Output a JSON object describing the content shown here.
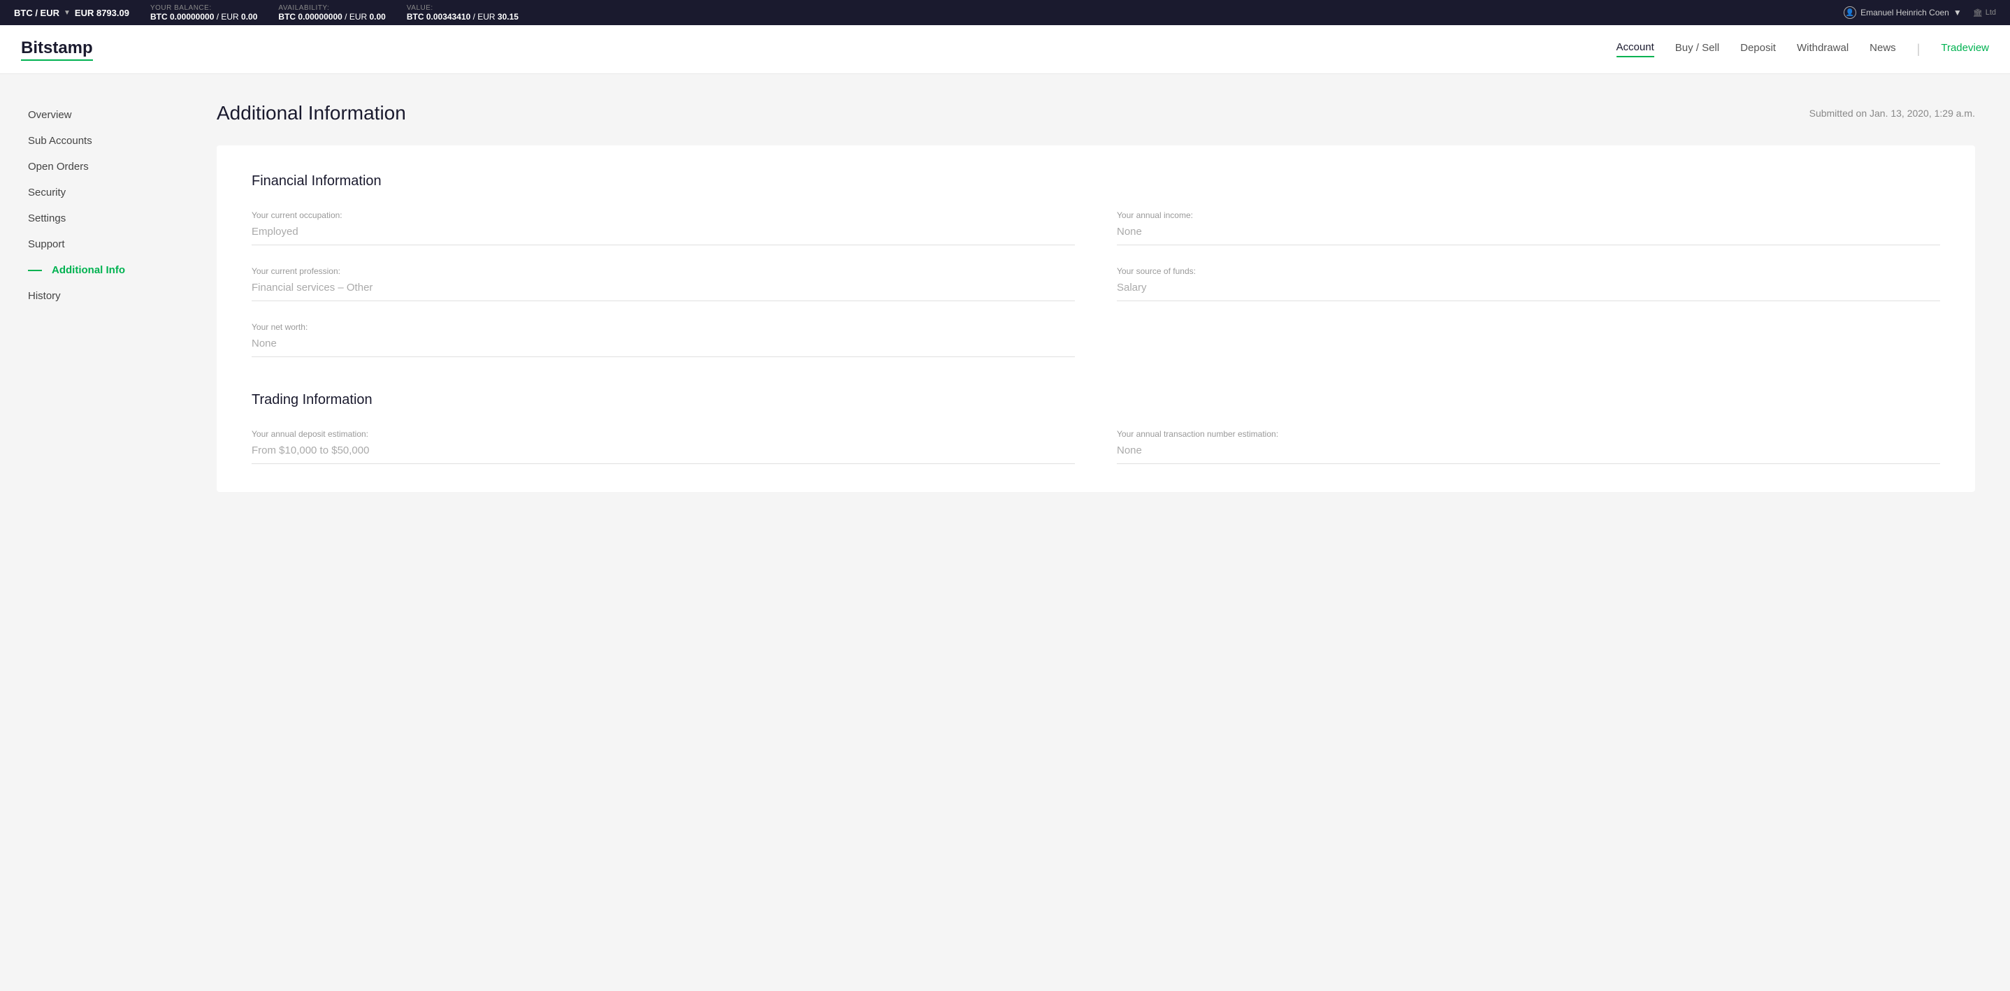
{
  "topbar": {
    "pair": "BTC / EUR",
    "pair_chevron": "▼",
    "price_label": "",
    "price": "EUR 8793.09",
    "balance_label": "YOUR BALANCE:",
    "balance_btc": "BTC 0.00000000",
    "balance_sep": "/ EUR",
    "balance_eur": "0.00",
    "availability_label": "AVAILABILITY:",
    "avail_btc": "BTC 0.00000000",
    "avail_sep": "/ EUR",
    "avail_eur": "0.00",
    "value_label": "VALUE:",
    "value_btc": "BTC 0.00343410",
    "value_sep": "/ EUR",
    "value_eur": "30.15",
    "user_name": "Emanuel Heinrich Coen",
    "user_chevron": "▼",
    "ltd_label": "Ltd"
  },
  "nav": {
    "account": "Account",
    "buy_sell": "Buy / Sell",
    "deposit": "Deposit",
    "withdrawal": "Withdrawal",
    "news": "News",
    "tradeview": "Tradeview"
  },
  "logo": "Bitstamp",
  "sidebar": {
    "items": [
      {
        "id": "overview",
        "label": "Overview",
        "active": false
      },
      {
        "id": "sub-accounts",
        "label": "Sub Accounts",
        "active": false
      },
      {
        "id": "open-orders",
        "label": "Open Orders",
        "active": false
      },
      {
        "id": "security",
        "label": "Security",
        "active": false
      },
      {
        "id": "settings",
        "label": "Settings",
        "active": false
      },
      {
        "id": "support",
        "label": "Support",
        "active": false
      },
      {
        "id": "additional-info",
        "label": "Additional Info",
        "active": true
      },
      {
        "id": "history",
        "label": "History",
        "active": false
      }
    ]
  },
  "page": {
    "title": "Additional Information",
    "submitted": "Submitted on Jan. 13, 2020, 1:29 a.m."
  },
  "financial_info": {
    "section_title": "Financial Information",
    "occupation_label": "Your current occupation:",
    "occupation_value": "Employed",
    "annual_income_label": "Your annual income:",
    "annual_income_value": "None",
    "profession_label": "Your current profession:",
    "profession_value": "Financial services – Other",
    "source_of_funds_label": "Your source of funds:",
    "source_of_funds_value": "Salary",
    "net_worth_label": "Your net worth:",
    "net_worth_value": "None"
  },
  "trading_info": {
    "section_title": "Trading Information",
    "deposit_label": "Your annual deposit estimation:",
    "deposit_value": "From $10,000 to $50,000",
    "transaction_label": "Your annual transaction number estimation:",
    "transaction_value": "None"
  }
}
